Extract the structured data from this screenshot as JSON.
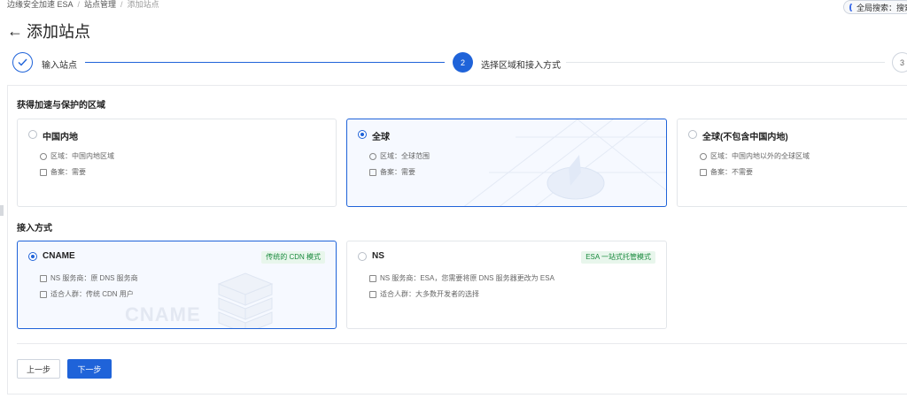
{
  "breadcrumb": [
    "边缘安全加速 ESA",
    "站点管理",
    "添加站点"
  ],
  "global_search": "全局搜索：搜索",
  "title": "添加站点",
  "steps": [
    {
      "number": "1",
      "label": "输入站点",
      "status": "done"
    },
    {
      "number": "2",
      "label": "选择区域和接入方式",
      "status": "active"
    },
    {
      "number": "3",
      "label": "",
      "status": "pending"
    }
  ],
  "region_section": {
    "title": "获得加速与保护的区域",
    "options": [
      {
        "title": "中国内地",
        "region": "区域：中国内地区域",
        "icp": "备案：需要",
        "selected": false
      },
      {
        "title": "全球",
        "region": "区域：全球范围",
        "icp": "备案：需要",
        "selected": true
      },
      {
        "title": "全球(不包含中国内地)",
        "region": "区域：中国内地以外的全球区域",
        "icp": "备案：不需要",
        "selected": false
      }
    ]
  },
  "access_section": {
    "title": "接入方式",
    "options": [
      {
        "title": "CNAME",
        "tag": "传统的 CDN 模式",
        "provider": "NS 服务商：原 DNS 服务商",
        "audience": "适合人群：传统 CDN 用户",
        "watermark": "CNAME",
        "selected": true
      },
      {
        "title": "NS",
        "tag": "ESA 一站式托管模式",
        "provider": "NS 服务商：ESA，您需要将原 DNS 服务器更改为 ESA",
        "audience": "适合人群：大多数开发者的选择",
        "selected": false
      }
    ]
  },
  "buttons": {
    "prev": "上一步",
    "next": "下一步"
  },
  "colors": {
    "accent": "#1f63d9",
    "tag_text": "#1a8a3e",
    "tag_bg": "#e8f6ec"
  }
}
